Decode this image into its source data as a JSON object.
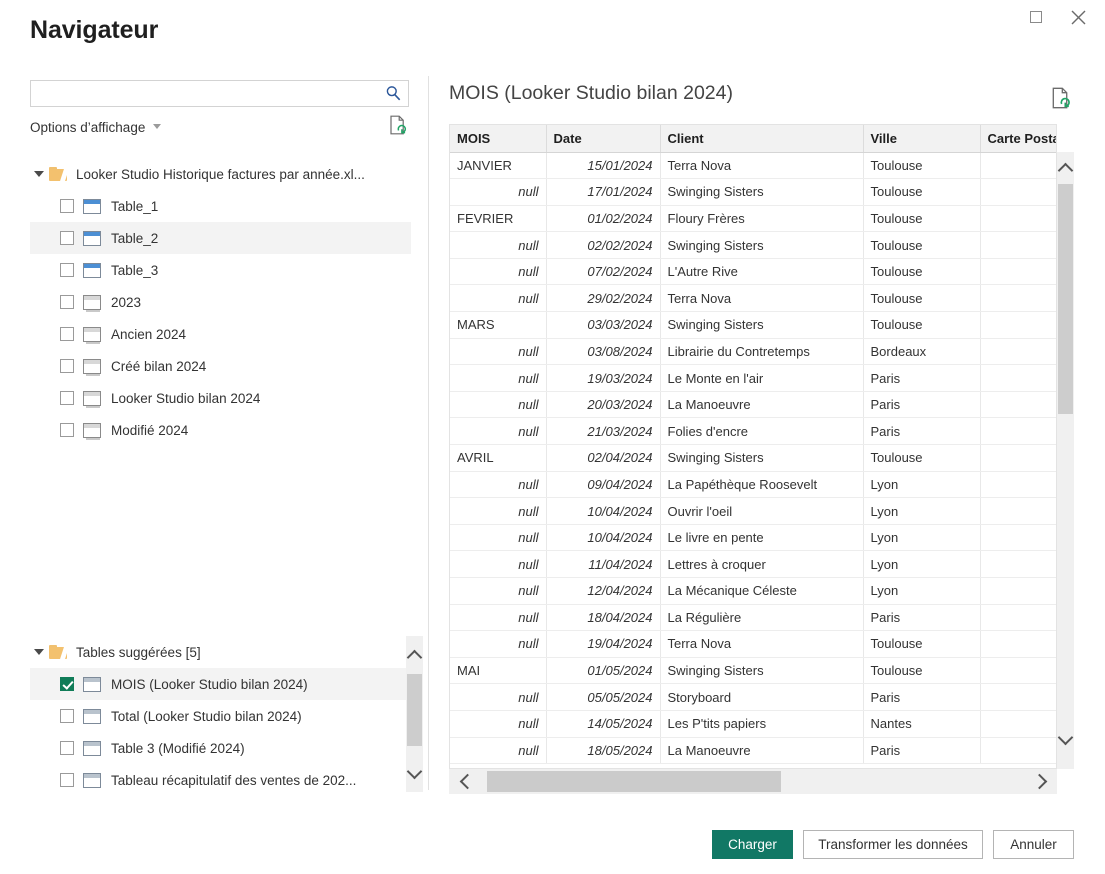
{
  "window": {
    "title": "Navigateur",
    "controls": [
      {
        "name": "maximize",
        "glyph": "□"
      },
      {
        "name": "close",
        "glyph": "✕"
      }
    ]
  },
  "search": {
    "value": "",
    "placeholder": "",
    "icon": "search-icon"
  },
  "display_options": {
    "label": "Options d’affichage",
    "caret": "chevron-down-icon",
    "refresh_icon": "refresh-document-icon"
  },
  "tree": {
    "root": {
      "label": "Looker Studio Historique factures par année.xl...",
      "icon": "folder-icon",
      "expanded": true
    },
    "items": [
      {
        "label": "Table_1",
        "icon": "table-icon",
        "checked": false,
        "selected": false
      },
      {
        "label": "Table_2",
        "icon": "table-icon",
        "checked": false,
        "selected": true
      },
      {
        "label": "Table_3",
        "icon": "table-icon",
        "checked": false,
        "selected": false
      },
      {
        "label": "2023",
        "icon": "sheet-icon",
        "checked": false,
        "selected": false
      },
      {
        "label": "Ancien 2024",
        "icon": "sheet-icon",
        "checked": false,
        "selected": false
      },
      {
        "label": "Créé bilan 2024",
        "icon": "sheet-icon",
        "checked": false,
        "selected": false
      },
      {
        "label": "Looker Studio bilan 2024",
        "icon": "sheet-icon",
        "checked": false,
        "selected": false
      },
      {
        "label": "Modifié 2024",
        "icon": "sheet-icon",
        "checked": false,
        "selected": false
      }
    ],
    "suggested": {
      "label": "Tables suggérées [5]",
      "icon": "folder-icon",
      "expanded": true,
      "items": [
        {
          "label": "MOIS (Looker Studio bilan 2024)",
          "icon": "table-icon",
          "checked": true,
          "selected": true
        },
        {
          "label": "Total (Looker Studio bilan 2024)",
          "icon": "table-icon",
          "checked": false,
          "selected": false
        },
        {
          "label": "Table 3 (Modifié 2024)",
          "icon": "table-icon",
          "checked": false,
          "selected": false
        },
        {
          "label": "Tableau récapitulatif des ventes de 202...",
          "icon": "table-icon",
          "checked": false,
          "selected": false
        }
      ]
    }
  },
  "preview": {
    "title": "MOIS (Looker Studio bilan 2024)",
    "refresh_icon": "refresh-document-icon",
    "columns": [
      "MOIS",
      "Date",
      "Client",
      "Ville",
      "Carte Postale"
    ],
    "rows": [
      [
        "JANVIER",
        "15/01/2024",
        "Terra Nova",
        "Toulouse",
        ""
      ],
      [
        "null",
        "17/01/2024",
        "Swinging Sisters",
        "Toulouse",
        ""
      ],
      [
        "FEVRIER",
        "01/02/2024",
        "Floury Frères",
        "Toulouse",
        ""
      ],
      [
        "null",
        "02/02/2024",
        "Swinging Sisters",
        "Toulouse",
        ""
      ],
      [
        "null",
        "07/02/2024",
        "L'Autre Rive",
        "Toulouse",
        ""
      ],
      [
        "null",
        "29/02/2024",
        "Terra Nova",
        "Toulouse",
        ""
      ],
      [
        "MARS",
        "03/03/2024",
        "Swinging Sisters",
        "Toulouse",
        ""
      ],
      [
        "null",
        "03/08/2024",
        "Librairie du Contretemps",
        "Bordeaux",
        ""
      ],
      [
        "null",
        "19/03/2024",
        "Le Monte en l'air",
        "Paris",
        ""
      ],
      [
        "null",
        "20/03/2024",
        "La Manoeuvre",
        "Paris",
        ""
      ],
      [
        "null",
        "21/03/2024",
        "Folies d'encre",
        "Paris",
        ""
      ],
      [
        "AVRIL",
        "02/04/2024",
        "Swinging Sisters",
        "Toulouse",
        ""
      ],
      [
        "null",
        "09/04/2024",
        "La Papéthèque Roosevelt",
        "Lyon",
        ""
      ],
      [
        "null",
        "10/04/2024",
        "Ouvrir l'oeil",
        "Lyon",
        ""
      ],
      [
        "null",
        "10/04/2024",
        "Le livre en pente",
        "Lyon",
        ""
      ],
      [
        "null",
        "11/04/2024",
        "Lettres à croquer",
        "Lyon",
        ""
      ],
      [
        "null",
        "12/04/2024",
        "La Mécanique Céleste",
        "Lyon",
        ""
      ],
      [
        "null",
        "18/04/2024",
        "La Régulière",
        "Paris",
        ""
      ],
      [
        "null",
        "19/04/2024",
        "Terra Nova",
        "Toulouse",
        ""
      ],
      [
        "MAI",
        "01/05/2024",
        "Swinging Sisters",
        "Toulouse",
        ""
      ],
      [
        "null",
        "05/05/2024",
        "Storyboard",
        "Paris",
        ""
      ],
      [
        "null",
        "14/05/2024",
        "Les P'tits papiers",
        "Nantes",
        ""
      ],
      [
        "null",
        "18/05/2024",
        "La Manoeuvre",
        "Paris",
        ""
      ]
    ]
  },
  "footer": {
    "load_label": "Charger",
    "transform_label": "Transformer les données",
    "cancel_label": "Annuler"
  },
  "colors": {
    "accent_green": "#117865",
    "checkbox_green": "#107C58",
    "header_bg": "#f2f2f2",
    "selection_bg": "#f3f3f3",
    "search_icon_blue": "#2b579a"
  }
}
